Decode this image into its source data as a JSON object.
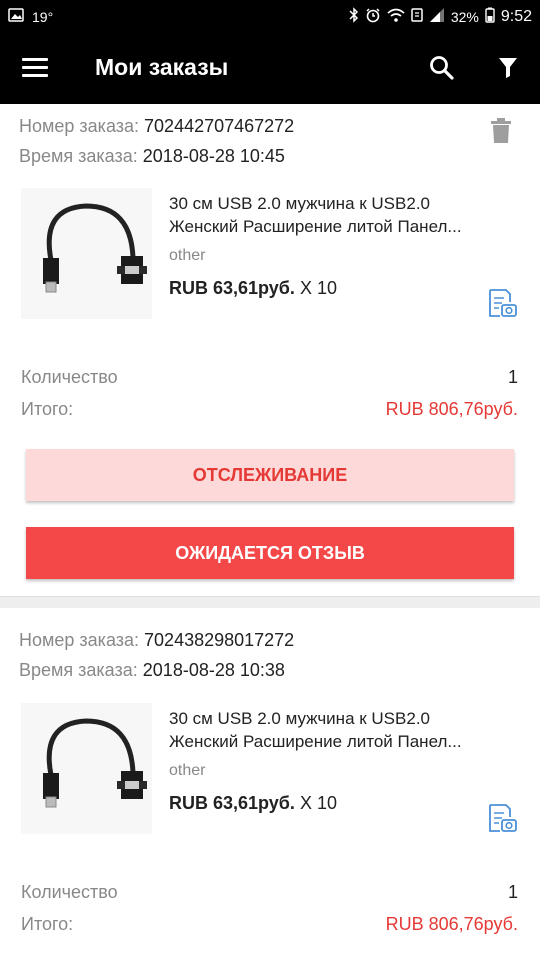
{
  "status_bar": {
    "temperature": "19°",
    "battery": "32%",
    "time": "9:52"
  },
  "app_bar": {
    "title": "Мои заказы"
  },
  "colors": {
    "accent": "#f44848",
    "accent_light": "#fdd9d9",
    "price_red": "#e53935",
    "icon_blue": "#4a90d9"
  },
  "orders": [
    {
      "number_label": "Номер заказа:",
      "number": "702442707467272",
      "time_label": "Время заказа:",
      "time": "2018-08-28 10:45",
      "product": {
        "title_line1": "30 см USB 2.0 мужчина к USB2.0",
        "title_line2": "Женский Расширение литой Панел...",
        "variant": "other",
        "price": "RUB 63,61руб.",
        "quantity": "X 10"
      },
      "qty_label": "Количество",
      "qty_value": "1",
      "total_label": "Итого:",
      "total_value": "RUB 806,76руб.",
      "track_label": "ОТСЛЕЖИВАНИЕ",
      "review_label": "ОЖИДАЕТСЯ ОТЗЫВ"
    },
    {
      "number_label": "Номер заказа:",
      "number": "702438298017272",
      "time_label": "Время заказа:",
      "time": "2018-08-28 10:38",
      "product": {
        "title_line1": "30 см USB 2.0 мужчина к USB2.0",
        "title_line2": "Женский Расширение литой Панел...",
        "variant": "other",
        "price": "RUB 63,61руб.",
        "quantity": "X 10"
      },
      "qty_label": "Количество",
      "qty_value": "1",
      "total_label": "Итого:",
      "total_value": "RUB 806,76руб."
    }
  ]
}
